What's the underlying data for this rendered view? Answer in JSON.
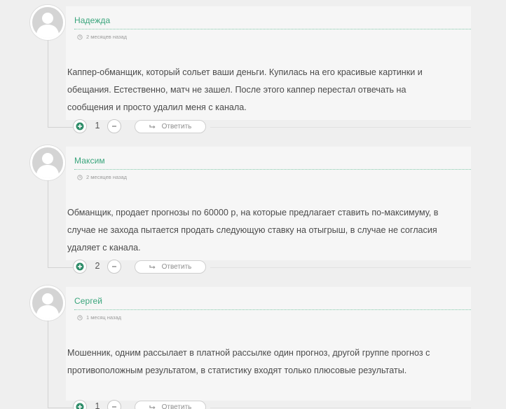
{
  "comments": [
    {
      "author": "Надежда",
      "time": "2 месяцев назад",
      "lines": [
        "Каппер-обманщик, который сольет ваши деньги. Купилась на его красивые картинки и",
        "обещания. Естественно, матч не зашел. После этого каппер перестал отвечать на",
        "сообщения и просто удалил меня с канала."
      ],
      "votes": "1",
      "reply_label": "Ответить"
    },
    {
      "author": "Максим",
      "time": "2 месяцев назад",
      "lines": [
        "Обманщик, продает прогнозы по 60000 р, на которые предлагает ставить по-максимуму, в",
        "случае не захода пытается продать следующую ставку на отыгрыш, в случае не согласия",
        "удаляет с канала."
      ],
      "votes": "2",
      "reply_label": "Ответить"
    },
    {
      "author": "Сергей",
      "time": "1 месяц назад",
      "lines": [
        "Мошенник, одним рассылает в платной рассылке один прогноз, другой группе прогноз с",
        "противоположным результатом, в статистику входят только плюсовые результаты."
      ],
      "votes": "1",
      "reply_label": "Ответить"
    }
  ],
  "colors": {
    "author": "#3aa57c",
    "vote_icon": "#2f8d69",
    "text": "#4b4b4b"
  },
  "icons": {
    "avatar": "user-silhouette-icon",
    "time": "clock-icon",
    "upvote": "plus-icon",
    "downvote": "minus-icon",
    "reply": "reply-arrow-icon"
  }
}
